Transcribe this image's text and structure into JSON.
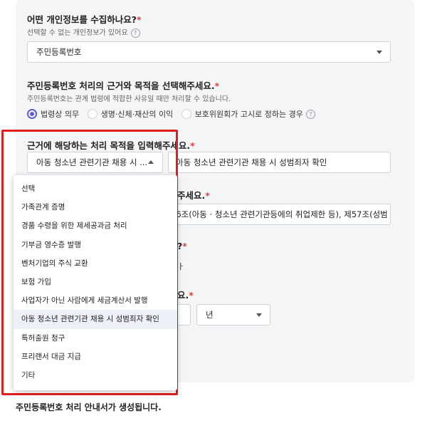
{
  "q1": {
    "title": "어떤 개인정보를 수집하나요?",
    "required_mark": "*",
    "subtitle": "선택할 수 없는 개인정보가 있어요",
    "select_value": "주민등록번호"
  },
  "q2": {
    "title": "주민등록번호 처리의 근거와 목적을 선택해주세요.",
    "required_mark": "*",
    "subtitle": "주민등록번호는 관계 법령에 적합한 사유일 때만 처리할 수 있습니다.",
    "radios": [
      {
        "label": "법령상 의무",
        "selected": true
      },
      {
        "label": "생명·신체·재산의 이익",
        "selected": false
      },
      {
        "label": "보호위원회가 고시로 정하는 경우",
        "selected": false
      }
    ]
  },
  "q3": {
    "title": "근거에 해당하는 처리 목적을 입력해주세요.",
    "required_mark": "*",
    "select_value": "아동 청소년 관련기관 채용 시 ...",
    "input_value": "아동 청소년 관련기관 채용 시 성범죄자 확인"
  },
  "q4": {
    "title_fragment": "주세요.",
    "required_mark": "*",
    "input_value": "56조(아동 · 청소년 관련기관등에의 취업제한 등), 제57조(성범"
  },
  "q5": {
    "title_fragment": "?",
    "required_mark": "*",
    "sub_fragment": "ㅏ"
  },
  "q6": {
    "title_fragment": "요.",
    "required_mark": "*",
    "unit_value": "년"
  },
  "dropdown": {
    "items": [
      "선택",
      "가족관계 증명",
      "경품 수령을 위한 제세공과금 처리",
      "기부금 영수증 발행",
      "벤처기업의 주식 교환",
      "보험 가입",
      "사업자가 아닌 사람에게 세금계산서 발행",
      "아동 청소년 관련기관 채용 시 성범죄자 확인",
      "특허출원 청구",
      "프리랜서 대금 지급",
      "기타"
    ],
    "selected_index": 7
  },
  "footer": {
    "text": "주민등록번호 처리 안내서가 생성됩니다."
  },
  "colors": {
    "accent": "#5b5bd6",
    "highlight": "#e11d1d",
    "required": "#e33c3c"
  },
  "icons": {
    "help": "question-circle-icon",
    "caret_down": "caret-down-icon",
    "caret_up": "caret-up-icon"
  }
}
